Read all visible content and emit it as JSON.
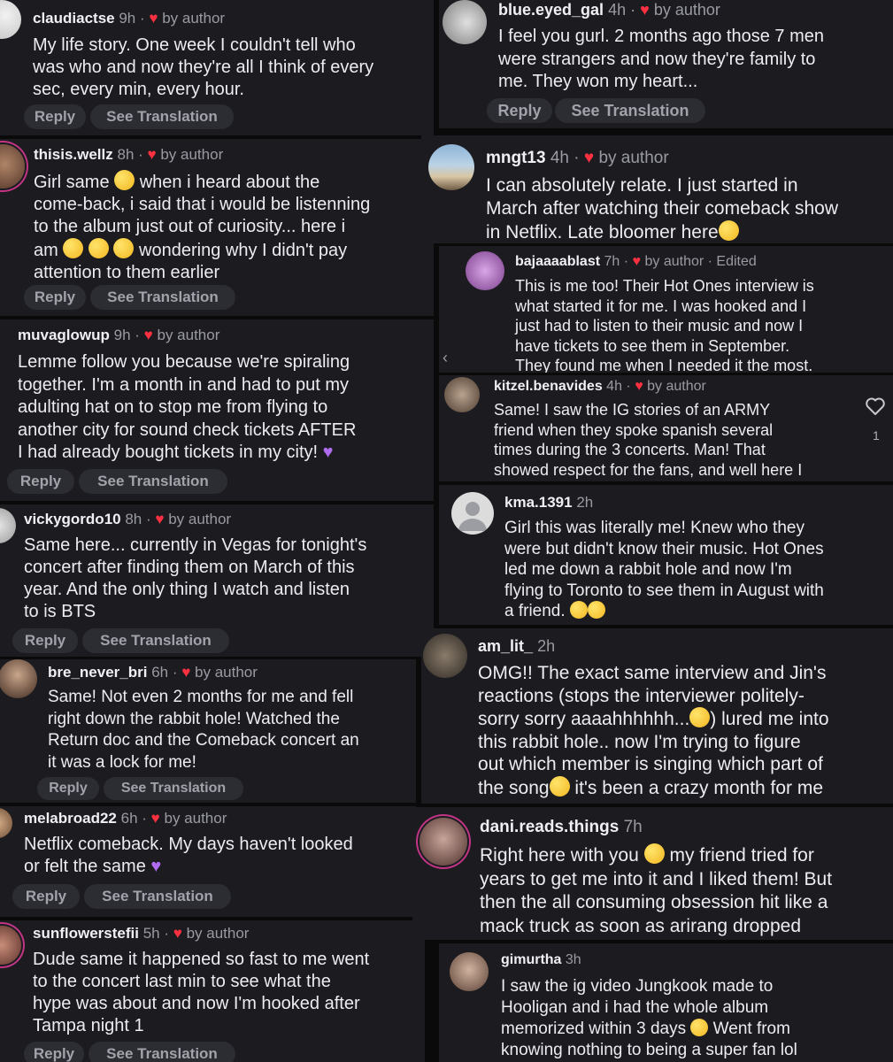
{
  "meta": {
    "dot": " · ",
    "heart": "♥",
    "by_author": "by author",
    "edited": " · Edited",
    "purple_heart": "♥"
  },
  "buttons": {
    "reply": "Reply",
    "see_translation": "See Translation"
  },
  "comments": {
    "c1": {
      "username": "claudiactse",
      "time": "9h",
      "t": [
        "My life story. One week I couldn't tell who",
        "was who and now they're all I think of every",
        "sec, every min, every hour."
      ]
    },
    "c2": {
      "username": "thisis.wellz",
      "time": "8h",
      "t": [
        "Girl same",
        "when i heard about the",
        "come-back, i said that i would be listenning",
        "to the album just out of curiosity... here i",
        "am",
        "wondering why I didn't pay",
        "attention to them earlier"
      ]
    },
    "c3": {
      "username": "muvaglowup",
      "time": "9h",
      "t": [
        "Lemme follow you because we're spiraling",
        "together. I'm a month in and had to put my",
        "adulting hat on to stop me from flying to",
        "another city for sound check tickets AFTER",
        "I had already bought tickets in my city!"
      ]
    },
    "c4": {
      "username": "vickygordo10",
      "time": "8h",
      "t": [
        "Same here... currently in Vegas for tonight's",
        "concert after finding them on March of this",
        "year. And the only thing I watch and listen",
        "to is BTS"
      ]
    },
    "c5": {
      "username": "bre_never_bri",
      "time": "6h",
      "t": [
        "Same! Not even 2 months for me and fell",
        "right down the rabbit hole! Watched the",
        "Return doc and the Comeback concert an",
        "it was a lock for me!"
      ]
    },
    "c6": {
      "username": "melabroad22",
      "time": "6h",
      "t": [
        "Netflix comeback. My days haven't looked",
        "or felt the same"
      ]
    },
    "c7": {
      "username": "sunflowerstefii",
      "time": "5h",
      "t": [
        "Dude same it happened so fast to me went",
        "to the concert last min to see what the",
        "hype was about and now I'm hooked after",
        "Tampa night 1"
      ]
    },
    "c8": {
      "username": "blue.eyed_gal",
      "time": "4h",
      "t": [
        "I feel you gurl. 2 months ago those 7 men",
        "were strangers and now they're family to",
        "me. They won my heart..."
      ]
    },
    "c9": {
      "username": "mngt13",
      "time": "4h",
      "t": [
        "I can absolutely relate. I just started in",
        "March after watching their comeback show",
        "in Netflix. Late bloomer here"
      ]
    },
    "c10": {
      "username": "bajaaaablast",
      "time": "7h",
      "t": [
        "This is me too! Their Hot Ones interview is",
        "what started it for me. I was hooked and I",
        "just had to listen to their music and now I",
        "have tickets to see them in September.",
        "They found me when I needed it the most."
      ]
    },
    "c11": {
      "username": "kitzel.benavides",
      "time": "4h",
      "like_count": "1",
      "t": [
        "Same! I saw  the IG stories of an ARMY",
        "friend when they spoke spanish several",
        "times during the 3 concerts. Man! That",
        "showed respect for the fans, and well here I"
      ]
    },
    "c12": {
      "username": "kma.1391",
      "time": "2h",
      "t": [
        "Girl this was literally me! Knew who they",
        "were but didn't know their music. Hot Ones",
        "led me down a rabbit hole and now I'm",
        "flying to Toronto to see them in August with",
        "a friend."
      ]
    },
    "c13": {
      "username": "am_lit_",
      "time": "2h",
      "t": [
        "OMG!! The exact same interview and Jin's",
        "reactions (stops the interviewer politely-",
        "sorry sorry aaaahhhhhh...",
        ") lured me into",
        "this rabbit hole.. now I'm trying to figure",
        "out which member is singing which part of",
        "the song",
        "it's been a crazy month for me"
      ]
    },
    "c14": {
      "username": "dani.reads.things",
      "time": "7h",
      "t": [
        "Right here with you",
        "my friend tried for",
        "years to get me into it and I liked them! But",
        "then the all consuming obsession hit like a",
        "mack truck as soon as arirang dropped"
      ]
    },
    "c15": {
      "username": "gimurtha",
      "time": "3h",
      "t": [
        "I saw the ig video Jungkook made to",
        "Hooligan and i had the whole album",
        "memorized within 3 days",
        "Went from",
        "knowing nothing to being a super fan lol"
      ]
    }
  },
  "colors": {
    "background": "#0a0a0b",
    "panel": "#1b1b20",
    "heart": "#ff3040",
    "button": "#2c2c33",
    "purple_heart": "#b06cf0"
  }
}
